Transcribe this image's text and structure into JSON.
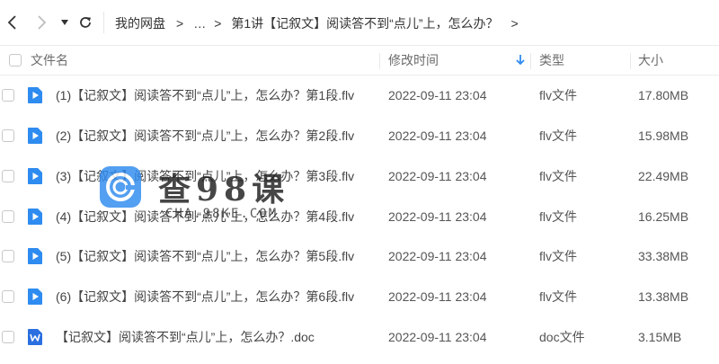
{
  "nav": {
    "breadcrumbs": [
      "我的网盘",
      "…",
      "第1讲【记叙文】阅读答不到“点儿”上，怎么办？"
    ]
  },
  "header": {
    "col_name": "文件名",
    "col_modified": "修改时间",
    "col_type": "类型",
    "col_size": "大小"
  },
  "files": [
    {
      "name": "(1)【记叙文】阅读答不到“点儿”上，怎么办？第1段.flv",
      "modified": "2022-09-11 23:04",
      "type": "flv文件",
      "size": "17.80MB",
      "icon": "video-file-icon"
    },
    {
      "name": "(2)【记叙文】阅读答不到“点儿”上，怎么办？第2段.flv",
      "modified": "2022-09-11 23:04",
      "type": "flv文件",
      "size": "15.98MB",
      "icon": "video-file-icon"
    },
    {
      "name": "(3)【记叙文】阅读答不到“点儿”上，怎么办？第3段.flv",
      "modified": "2022-09-11 23:04",
      "type": "flv文件",
      "size": "22.49MB",
      "icon": "video-file-icon"
    },
    {
      "name": "(4)【记叙文】阅读答不到“点儿”上，怎么办？第4段.flv",
      "modified": "2022-09-11 23:04",
      "type": "flv文件",
      "size": "16.25MB",
      "icon": "video-file-icon"
    },
    {
      "name": "(5)【记叙文】阅读答不到“点儿”上，怎么办？第5段.flv",
      "modified": "2022-09-11 23:04",
      "type": "flv文件",
      "size": "33.38MB",
      "icon": "video-file-icon"
    },
    {
      "name": "(6)【记叙文】阅读答不到“点儿”上，怎么办？第6段.flv",
      "modified": "2022-09-11 23:04",
      "type": "flv文件",
      "size": "13.38MB",
      "icon": "video-file-icon"
    },
    {
      "name": "【记叙文】阅读答不到“点儿”上，怎么办？.doc",
      "modified": "2022-09-11 23:04",
      "type": "doc文件",
      "size": "3.15MB",
      "icon": "word-file-icon"
    }
  ],
  "watermark": {
    "title": "查98课",
    "url": "CHA.98KE.COM"
  },
  "colors": {
    "accent": "#2e8bf0",
    "word_blue": "#2b6fe0"
  }
}
